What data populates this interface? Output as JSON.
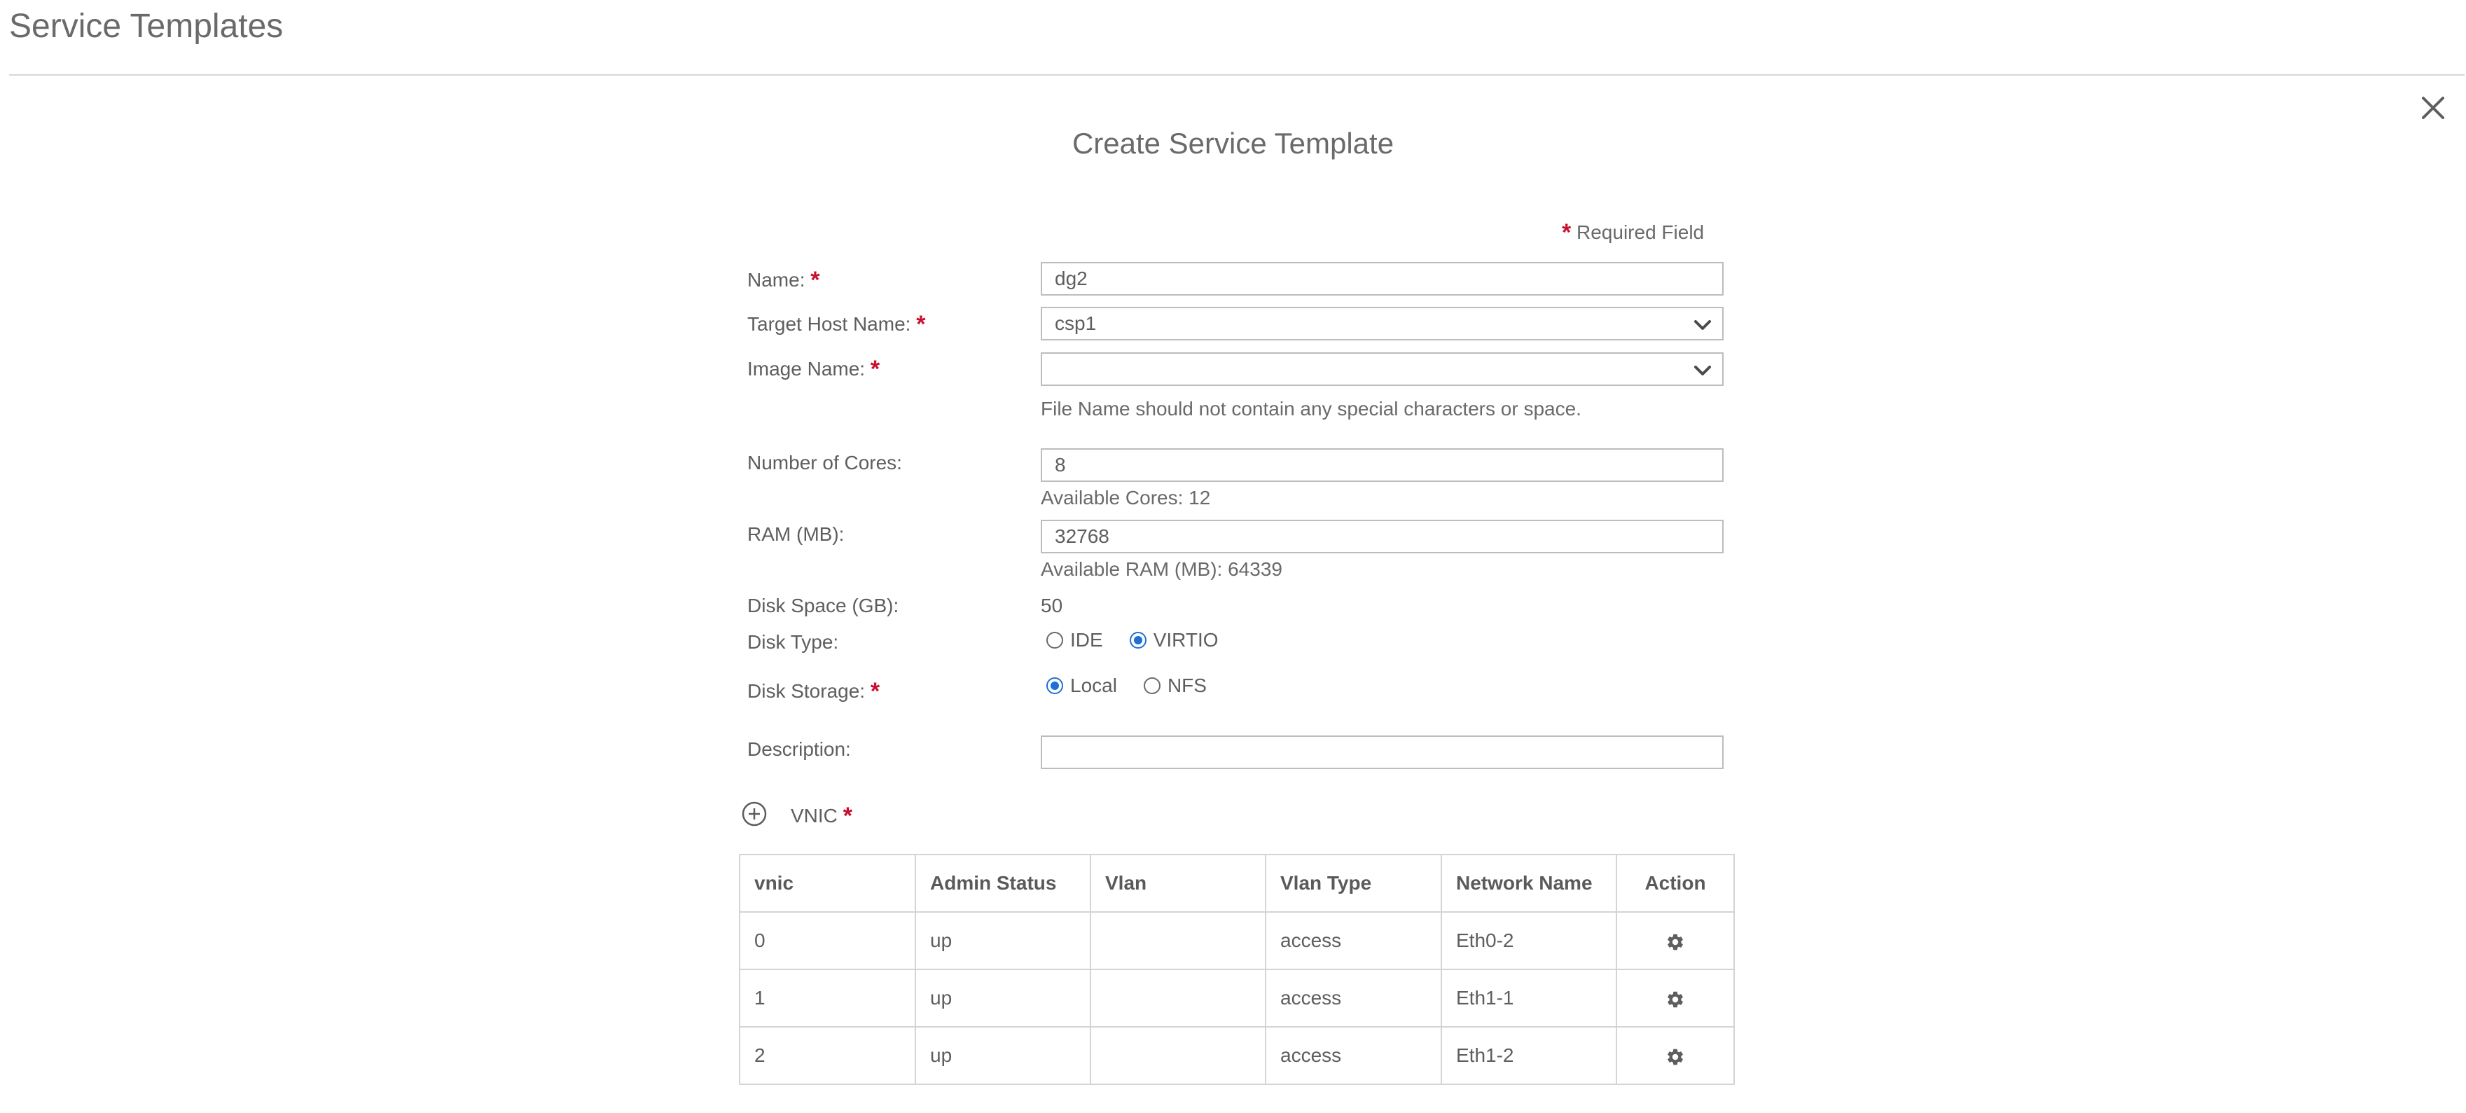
{
  "page": {
    "title": "Service Templates"
  },
  "dialog": {
    "title": "Create Service Template",
    "required_star": "*",
    "required_text": "Required Field"
  },
  "form": {
    "name": {
      "label": "Name:",
      "value": "dg2"
    },
    "target_host": {
      "label": "Target Host Name:",
      "value": "csp1"
    },
    "image_name": {
      "label": "Image Name:",
      "value": "",
      "hint": "File Name should not contain any special characters or space."
    },
    "cores": {
      "label": "Number of Cores:",
      "value": "8",
      "hint": "Available Cores: 12"
    },
    "ram": {
      "label": "RAM (MB):",
      "value": "32768",
      "hint": "Available RAM (MB): 64339"
    },
    "disk_space": {
      "label": "Disk Space (GB):",
      "value": "50"
    },
    "disk_type": {
      "label": "Disk Type:",
      "options": [
        "IDE",
        "VIRTIO"
      ],
      "selected": "VIRTIO"
    },
    "disk_storage": {
      "label": "Disk Storage:",
      "options": [
        "Local",
        "NFS"
      ],
      "selected": "Local"
    },
    "description": {
      "label": "Description:",
      "value": ""
    }
  },
  "vnic": {
    "label": "VNIC",
    "columns": [
      "vnic",
      "Admin Status",
      "Vlan",
      "Vlan Type",
      "Network Name",
      "Action"
    ],
    "rows": [
      {
        "vnic": "0",
        "admin_status": "up",
        "vlan": "",
        "vlan_type": "access",
        "network_name": "Eth0-2"
      },
      {
        "vnic": "1",
        "admin_status": "up",
        "vlan": "",
        "vlan_type": "access",
        "network_name": "Eth1-1"
      },
      {
        "vnic": "2",
        "admin_status": "up",
        "vlan": "",
        "vlan_type": "access",
        "network_name": "Eth1-2"
      }
    ]
  },
  "icons": {
    "close": "close-icon",
    "add": "plus-circle-icon",
    "chevron": "chevron-down-icon",
    "action": "gear-icon"
  },
  "colors": {
    "required": "#c8102e",
    "radio_selected": "#1f6fd6",
    "border": "#bdbdbd"
  }
}
